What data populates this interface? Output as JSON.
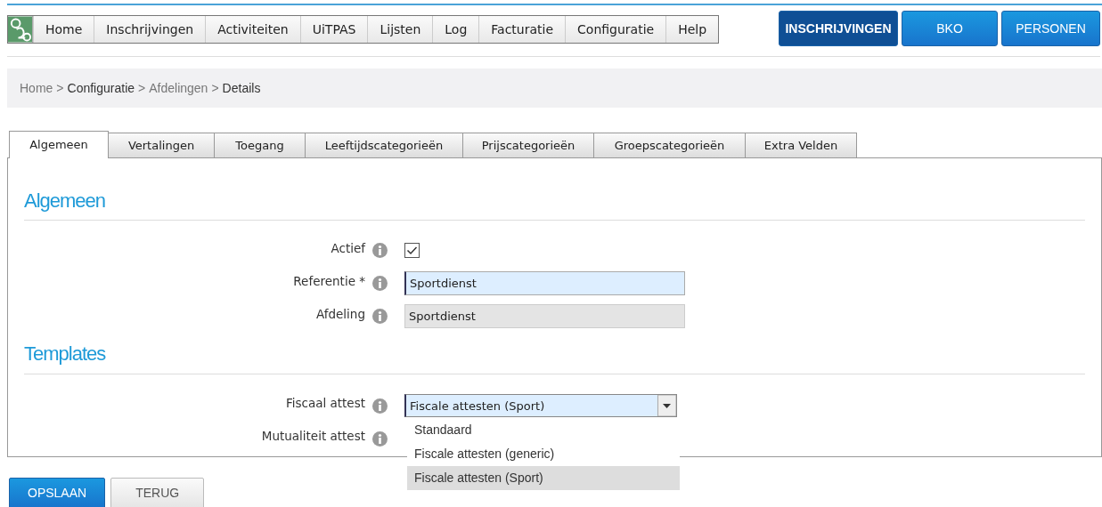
{
  "menu": [
    {
      "label": "Home"
    },
    {
      "label": "Inschrijvingen"
    },
    {
      "label": "Activiteiten"
    },
    {
      "label": "UiTPAS"
    },
    {
      "label": "Lijsten"
    },
    {
      "label": "Log"
    },
    {
      "label": "Facturatie"
    },
    {
      "label": "Configuratie"
    },
    {
      "label": "Help"
    }
  ],
  "modules": [
    {
      "label": "INSCHRIJVINGEN",
      "selected": true
    },
    {
      "label": "BKO",
      "selected": false
    },
    {
      "label": "PERSONEN",
      "selected": false
    }
  ],
  "breadcrumb": {
    "separator": ">",
    "items": [
      {
        "label": "Home",
        "link": true
      },
      {
        "label": "Configuratie",
        "link": false
      },
      {
        "label": "Afdelingen",
        "link": true
      },
      {
        "label": "Details",
        "link": false
      }
    ]
  },
  "tabs": [
    {
      "label": "Algemeen",
      "selected": true
    },
    {
      "label": "Vertalingen",
      "selected": false
    },
    {
      "label": "Toegang",
      "selected": false
    },
    {
      "label": "Leeftijdscategorieën",
      "selected": false
    },
    {
      "label": "Prijscategorieën",
      "selected": false
    },
    {
      "label": "Groepscategorieën",
      "selected": false
    },
    {
      "label": "Extra Velden",
      "selected": false
    }
  ],
  "sections": [
    {
      "title": "Algemeen",
      "fields": [
        {
          "label": "Actief",
          "kind": "checkbox",
          "checked": true
        },
        {
          "label": "Referentie *",
          "kind": "text",
          "value": "Sportdienst",
          "disabled": false
        },
        {
          "label": "Afdeling",
          "kind": "text",
          "value": "Sportdienst",
          "disabled": true
        }
      ]
    },
    {
      "title": "Templates",
      "fields": [
        {
          "label": "Fiscaal attest",
          "kind": "select",
          "value": "Fiscale attesten (Sport)",
          "expanded": true,
          "options": [
            {
              "label": "Standaard",
              "selected": false
            },
            {
              "label": "Fiscale attesten (generic)",
              "selected": false
            },
            {
              "label": "Fiscale attesten (Sport)",
              "selected": true
            }
          ]
        },
        {
          "label": "Mutualiteit attest",
          "kind": "hidden"
        }
      ]
    }
  ],
  "buttons": [
    {
      "label": "OPSLAAN",
      "kind": "primary"
    },
    {
      "label": "TERUG",
      "kind": "secondary"
    }
  ]
}
